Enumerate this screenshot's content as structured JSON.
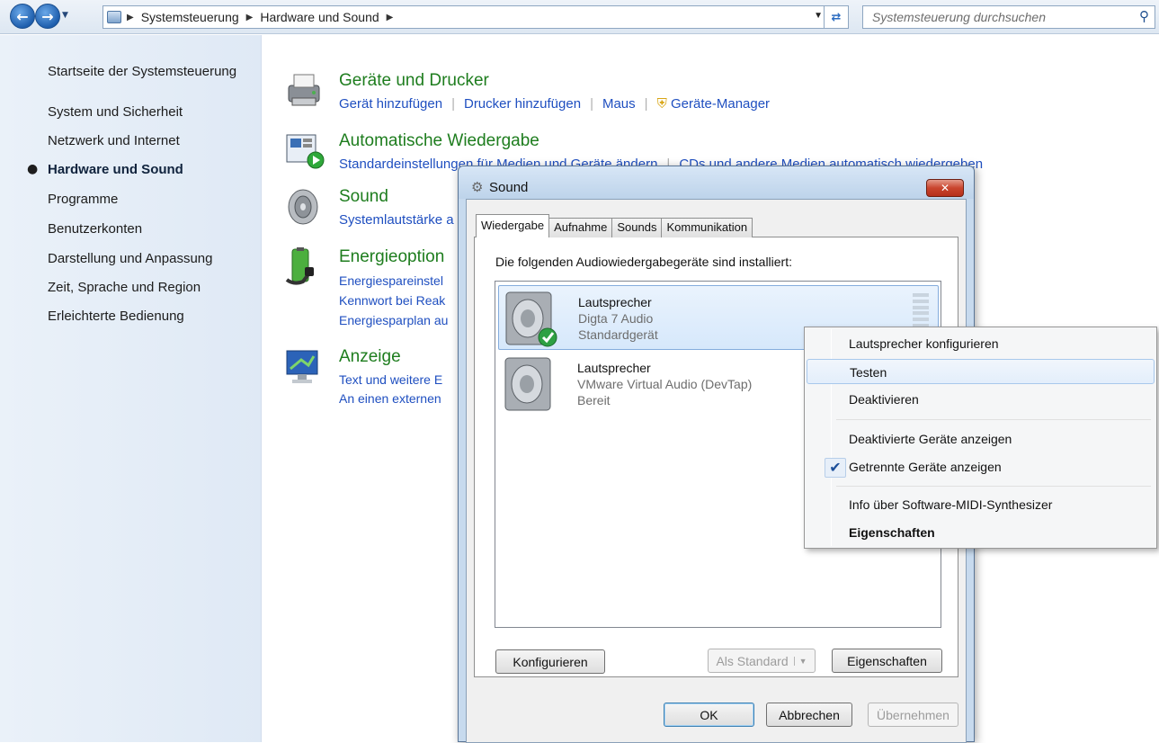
{
  "window": {
    "breadcrumb": [
      "Systemsteuerung",
      "Hardware und Sound"
    ],
    "search_placeholder": "Systemsteuerung durchsuchen"
  },
  "sidebar": {
    "home": "Startseite der Systemsteuerung",
    "items": [
      {
        "label": "System und Sicherheit",
        "active": false
      },
      {
        "label": "Netzwerk und Internet",
        "active": false
      },
      {
        "label": "Hardware und Sound",
        "active": true
      },
      {
        "label": "Programme",
        "active": false
      },
      {
        "label": "Benutzerkonten",
        "active": false
      },
      {
        "label": "Darstellung und Anpassung",
        "active": false
      },
      {
        "label": "Zeit, Sprache und Region",
        "active": false
      },
      {
        "label": "Erleichterte Bedienung",
        "active": false
      }
    ]
  },
  "categories": [
    {
      "title": "Geräte und Drucker",
      "links": [
        "Gerät hinzufügen",
        "Drucker hinzufügen",
        "Maus",
        "Geräte-Manager"
      ]
    },
    {
      "title": "Automatische Wiedergabe",
      "links": [
        "Standardeinstellungen für Medien und Geräte ändern",
        "CDs und andere Medien automatisch wiedergeben"
      ]
    },
    {
      "title": "Sound",
      "links": [
        "Systemlautstärke a"
      ]
    },
    {
      "title": "Energieoption",
      "links": [
        "Energiespareinstel",
        "Kennwort bei Reak",
        "Energiesparplan au"
      ]
    },
    {
      "title": "Anzeige",
      "links": [
        "Text und weitere E",
        "An einen externen"
      ]
    }
  ],
  "dialog": {
    "title": "Sound",
    "tabs": [
      "Wiedergabe",
      "Aufnahme",
      "Sounds",
      "Kommunikation"
    ],
    "description": "Die folgenden Audiowiedergabegeräte sind installiert:",
    "devices": [
      {
        "name": "Lautsprecher",
        "driver": "Digta 7 Audio",
        "status": "Standardgerät",
        "selected": true
      },
      {
        "name": "Lautsprecher",
        "driver": "VMware Virtual Audio (DevTap)",
        "status": "Bereit",
        "selected": false
      }
    ],
    "buttons": {
      "configure": "Konfigurieren",
      "set_default": "Als Standard",
      "properties": "Eigenschaften",
      "ok": "OK",
      "cancel": "Abbrechen",
      "apply": "Übernehmen"
    }
  },
  "context_menu": {
    "items": [
      {
        "label": "Lautsprecher konfigurieren"
      },
      {
        "label": "Testen",
        "highlighted": true
      },
      {
        "label": "Deaktivieren"
      },
      {
        "label": "Deaktivierte Geräte anzeigen"
      },
      {
        "label": "Getrennte Geräte anzeigen",
        "checked": true
      },
      {
        "label": "Info über Software-MIDI-Synthesizer"
      },
      {
        "label": "Eigenschaften",
        "bold": true
      }
    ]
  },
  "colors": {
    "link": "#1f4fc0",
    "category_title": "#1e7d1e",
    "sidebar_bg": "#e4edf7"
  }
}
